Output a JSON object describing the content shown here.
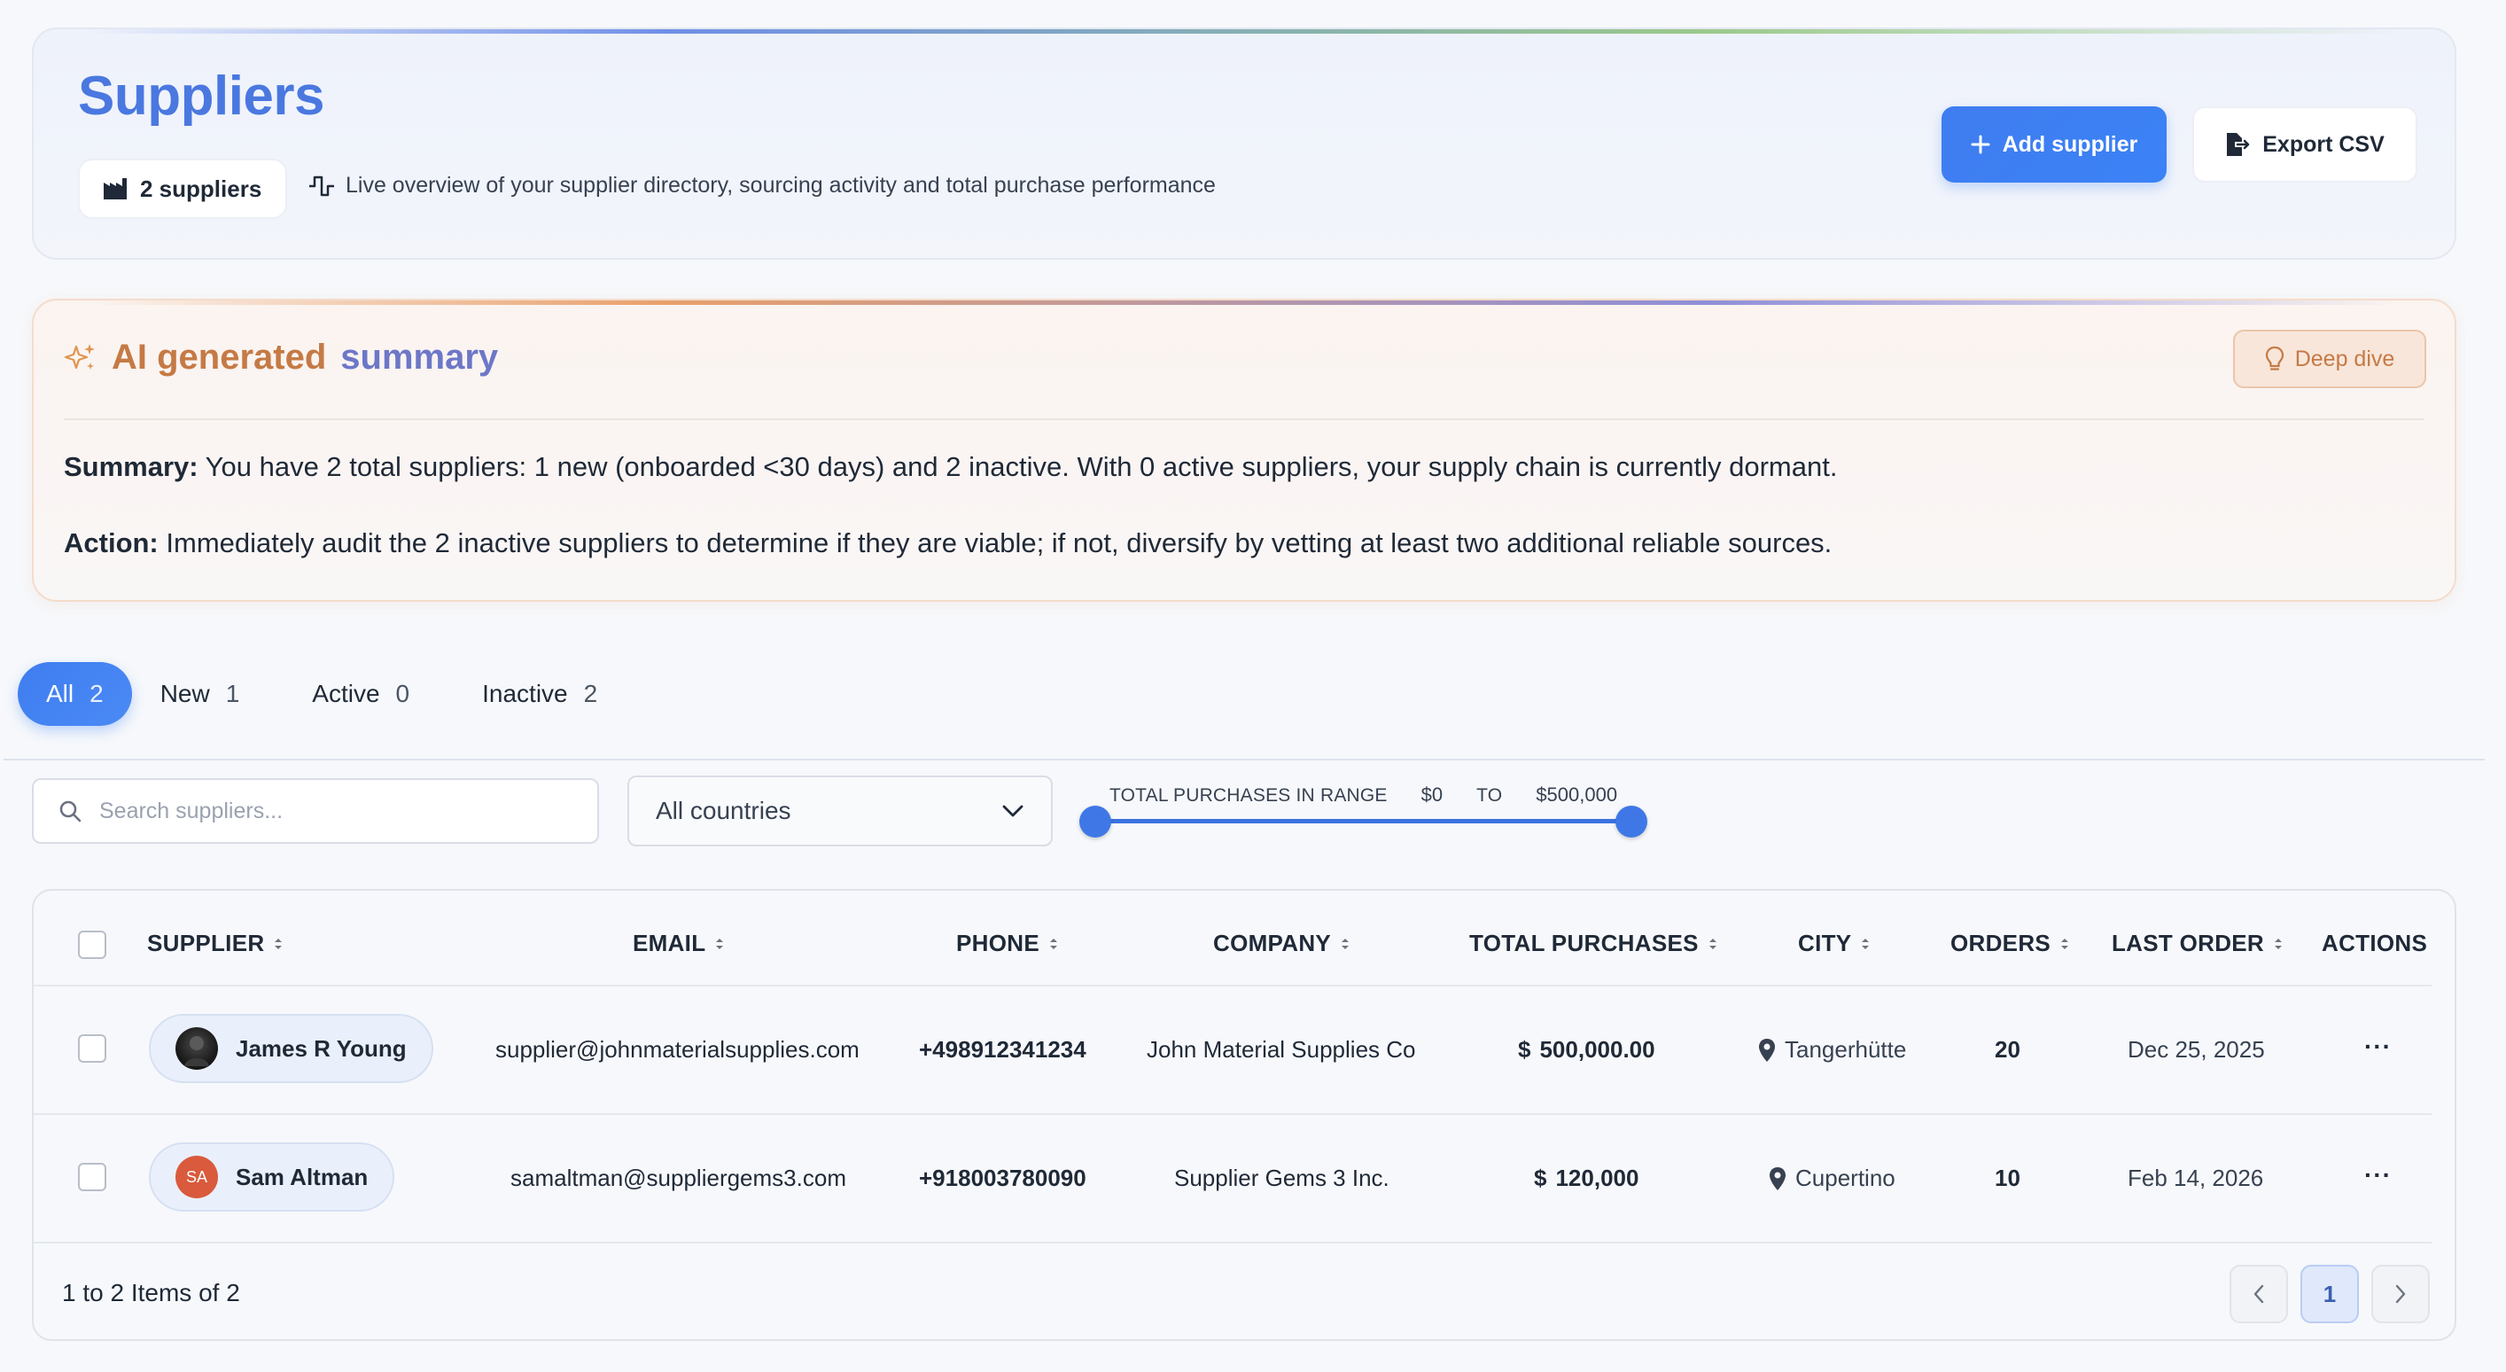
{
  "header": {
    "title": "Suppliers",
    "count_label": "2 suppliers",
    "subtitle": "Live overview of your supplier directory, sourcing activity and total purchase performance",
    "add_button": "Add supplier",
    "export_button": "Export CSV"
  },
  "ai_summary": {
    "title_part1": "AI generated",
    "title_part2": "summary",
    "deep_dive_label": "Deep dive",
    "summary_label": "Summary:",
    "summary_text": "You have 2 total suppliers: 1 new (onboarded <30 days) and 2 inactive. With 0 active suppliers, your supply chain is currently dormant.",
    "action_label": "Action:",
    "action_text": "Immediately audit the 2 inactive suppliers to determine if they are viable; if not, diversify by vetting at least two additional reliable sources."
  },
  "tabs": [
    {
      "label": "All",
      "count": "2",
      "active": true
    },
    {
      "label": "New",
      "count": "1",
      "active": false
    },
    {
      "label": "Active",
      "count": "0",
      "active": false
    },
    {
      "label": "Inactive",
      "count": "2",
      "active": false
    }
  ],
  "filters": {
    "search_placeholder": "Search suppliers...",
    "country_value": "All countries",
    "range_caption": "TOTAL PURCHASES IN RANGE",
    "range_min": "$0",
    "range_to": "TO",
    "range_max": "$500,000"
  },
  "table": {
    "columns": {
      "supplier": "SUPPLIER",
      "email": "EMAIL",
      "phone": "PHONE",
      "company": "COMPANY",
      "total_purchases": "TOTAL PURCHASES",
      "city": "CITY",
      "orders": "ORDERS",
      "last_order": "LAST ORDER",
      "actions": "ACTIONS"
    },
    "rows": [
      {
        "name": "James R Young",
        "avatar": "photo",
        "email": "supplier@johnmaterialsupplies.com",
        "phone": "+498912341234",
        "company": "John Material Supplies Co",
        "currency": "$",
        "total": "500,000.00",
        "city": "Tangerhütte",
        "orders": "20",
        "last_order": "Dec 25, 2025",
        "actions": "···"
      },
      {
        "name": "Sam Altman",
        "avatar": "initials",
        "initials": "SA",
        "email": "samaltman@suppliergems3.com",
        "phone": "+918003780090",
        "company": "Supplier Gems 3 Inc.",
        "currency": "$",
        "total": "120,000",
        "city": "Cupertino",
        "orders": "10",
        "last_order": "Feb 14, 2026",
        "actions": "···"
      }
    ],
    "footer_text": "1 to 2 Items of 2",
    "current_page": "1"
  },
  "colors": {
    "accent": "#3f7df0",
    "title_blue": "#4a78e0",
    "ai_orange": "#c57a45",
    "ai_purple": "#6d77c8"
  },
  "icons": {
    "add": "plus-icon",
    "export": "file-export-icon",
    "count_chip": "factory-icon",
    "subtitle": "pulse-icon",
    "ai_title": "sparkles-icon",
    "deep_dive": "lightbulb-icon",
    "search": "search-icon",
    "select": "chevron-down-icon",
    "city": "map-pin-icon",
    "pagination_prev": "chevron-left-icon",
    "pagination_next": "chevron-right-icon"
  }
}
